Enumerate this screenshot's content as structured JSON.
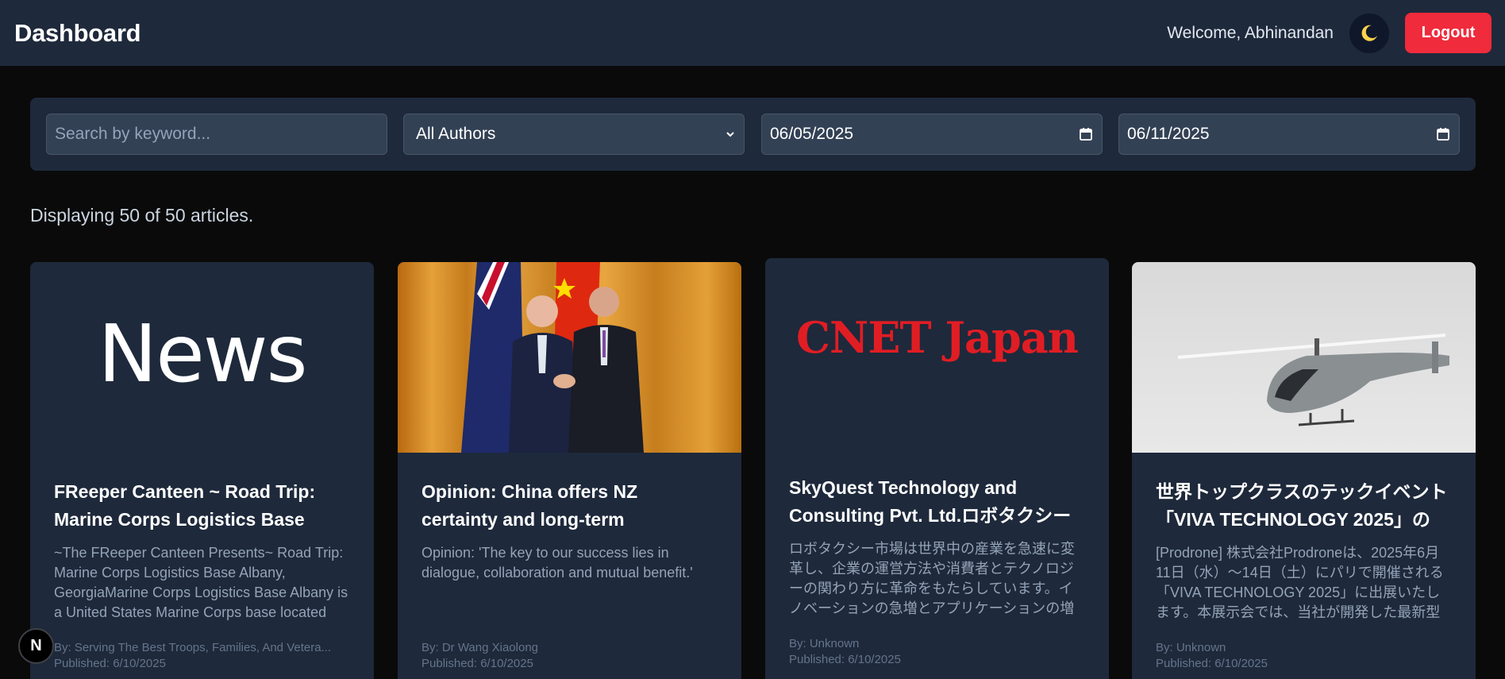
{
  "header": {
    "title": "Dashboard",
    "welcome": "Welcome, Abhinandan",
    "theme_icon": "moon-icon",
    "logout_label": "Logout"
  },
  "filters": {
    "search_placeholder": "Search by keyword...",
    "author_selected": "All Authors",
    "start_date": "06/05/2025",
    "end_date": "06/11/2025"
  },
  "status": {
    "count_text": "Displaying 50 of 50 articles."
  },
  "articles": [
    {
      "image_text": "News",
      "title": "FReeper Canteen ~ Road Trip: Marine Corps Logistics Base",
      "description": "~The FReeper Canteen Presents~ Road Trip: Marine Corps Logistics Base Albany, GeorgiaMarine Corps Logistics Base Albany is a United States Marine Corps base located",
      "author": "By: Serving The Best Troops, Families, And Vetera...",
      "published": "Published: 6/10/2025"
    },
    {
      "image_text": "",
      "title": "Opinion: China offers NZ certainty and long-term",
      "description": "Opinion: 'The key to our success lies in dialogue, collaboration and mutual benefit.'",
      "author": "By: Dr Wang Xiaolong",
      "published": "Published: 6/10/2025"
    },
    {
      "image_text": "CNET Japan",
      "title": "SkyQuest Technology and Consulting Pvt. Ltd.ロボタクシー",
      "description": "ロボタクシー市場は世界中の産業を急速に変革し、企業の運営方法や消費者とテクノロジーの関わり方に革命をもたらしています。イノベーションの急増とアプリケーションの増加に伴",
      "author": "By: Unknown",
      "published": "Published: 6/10/2025"
    },
    {
      "image_text": "",
      "title": "世界トップクラスのテックイベント「VIVA TECHNOLOGY 2025」の",
      "description": "[Prodrone] 株式会社Prodroneは、2025年6月11日（水）～14日（土）にパリで開催される「VIVA TECHNOLOGY 2025」に出展いたします。本展示会では、当社が開発した最新型ガソ",
      "author": "By: Unknown",
      "published": "Published: 6/10/2025"
    }
  ],
  "badge": {
    "letter": "N"
  },
  "colors": {
    "topbar": "#1e293b",
    "page_bg": "#0a0a0a",
    "card_bg": "#1e293b",
    "logout": "#ef2b3c",
    "cnet_red": "#e11d24"
  }
}
